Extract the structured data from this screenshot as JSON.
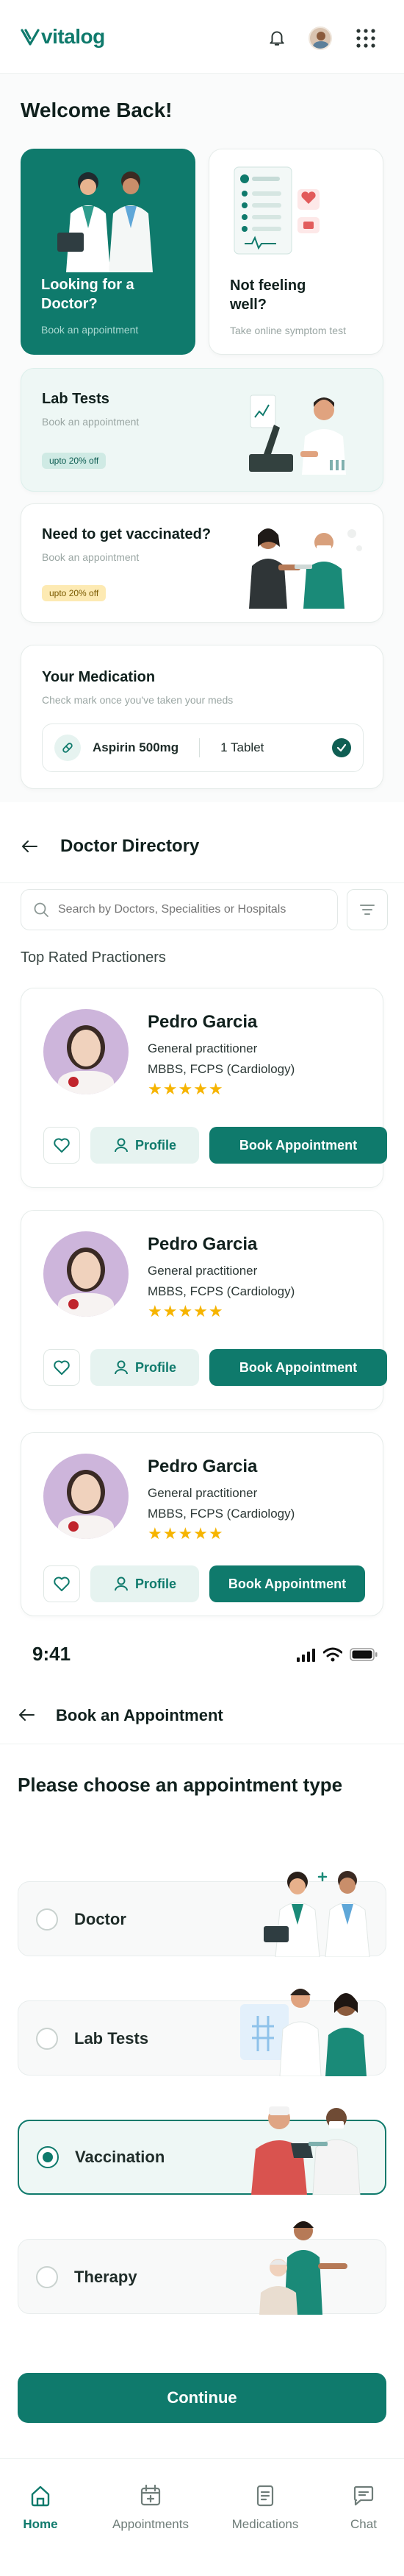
{
  "app": {
    "logo_text": "vitalog",
    "brand_color": "#0f7a6c"
  },
  "home": {
    "welcome": "Welcome Back!",
    "cards": {
      "doctor": {
        "title": "Looking for a Doctor?",
        "subtitle": "Book an appointment"
      },
      "symptom": {
        "title": "Not feeling well?",
        "subtitle": "Take online symptom test"
      },
      "lab": {
        "title": "Lab Tests",
        "subtitle": "Book an appointment",
        "badge": "upto 20% off"
      },
      "vaccine": {
        "title": "Need to get vaccinated?",
        "subtitle": "Book an appointment",
        "badge": "upto 20% off"
      }
    },
    "medication": {
      "title": "Your Medication",
      "subtitle": "Check mark once you've taken your meds",
      "item": {
        "name": "Aspirin 500mg",
        "dose": "1 Tablet"
      }
    }
  },
  "directory": {
    "title": "Doctor Directory",
    "search_placeholder": "Search by Doctors, Specialities or Hospitals",
    "section": "Top Rated Practioners",
    "doctors": [
      {
        "name": "Pedro Garcia",
        "role": "General practitioner",
        "degree": "MBBS, FCPS (Cardiology)",
        "rating": "★★★★★",
        "profile_label": "Profile",
        "book_label": "Book Appointment"
      },
      {
        "name": "Pedro Garcia",
        "role": "General practitioner",
        "degree": "MBBS, FCPS (Cardiology)",
        "rating": "★★★★★",
        "profile_label": "Profile",
        "book_label": "Book Appointment"
      },
      {
        "name": "Pedro Garcia",
        "role": "General practitioner",
        "degree": "MBBS, FCPS (Cardiology)",
        "rating": "★★★★★",
        "profile_label": "Profile",
        "book_label": "Book Appointment"
      }
    ]
  },
  "booking": {
    "status_time": "9:41",
    "title": "Book an Appointment",
    "heading": "Please choose an appointment type",
    "options": [
      {
        "label": "Doctor",
        "selected": false
      },
      {
        "label": "Lab Tests",
        "selected": false
      },
      {
        "label": "Vaccination",
        "selected": true
      },
      {
        "label": "Therapy",
        "selected": false
      }
    ],
    "continue_label": "Continue"
  },
  "bottom_nav": {
    "items": [
      {
        "label": "Home",
        "icon": "home-icon",
        "active": true
      },
      {
        "label": "Appointments",
        "icon": "calendar-plus-icon",
        "active": false
      },
      {
        "label": "Medications",
        "icon": "document-icon",
        "active": false
      },
      {
        "label": "Chat",
        "icon": "chat-icon",
        "active": false
      }
    ]
  }
}
